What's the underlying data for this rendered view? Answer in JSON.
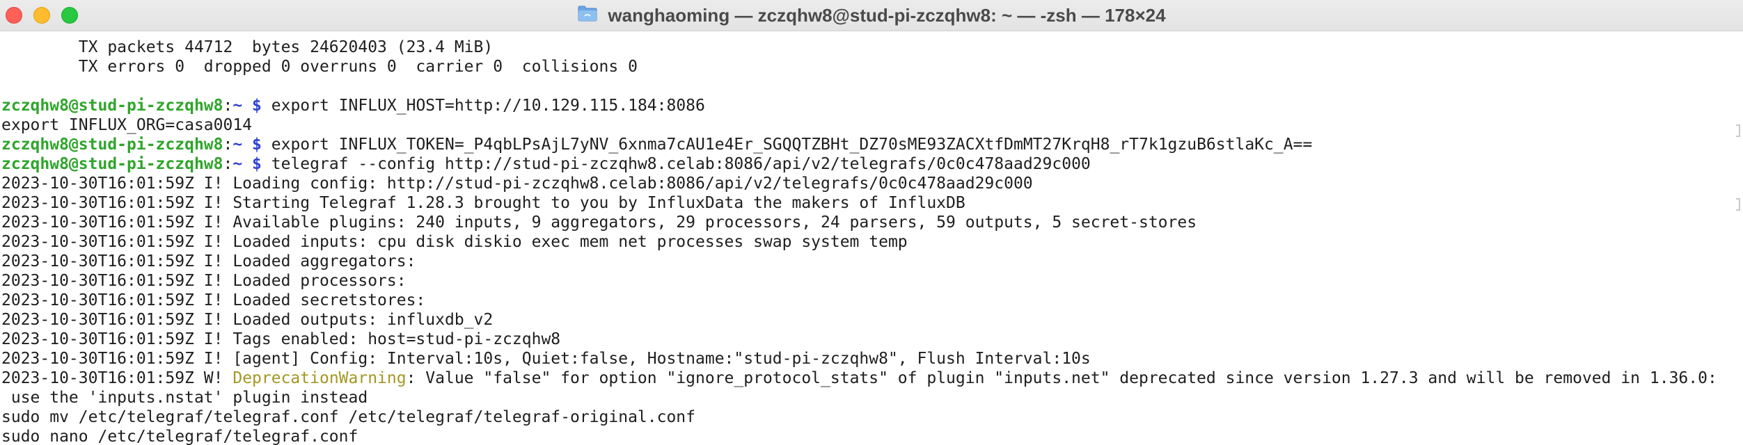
{
  "window": {
    "title": "wanghaoming — zczqhw8@stud-pi-zczqhw8: ~ — -zsh — 178×24",
    "folder_icon": "folder-icon"
  },
  "colors": {
    "prompt_user": "#2fa52b",
    "prompt_path": "#2e41d4",
    "warning": "#a49722",
    "text": "#1e1e1e"
  },
  "terminal": {
    "lines": [
      {
        "text": "        TX packets 44712  bytes 24620403 (23.4 MiB)"
      },
      {
        "text": "        TX errors 0  dropped 0 overruns 0  carrier 0  collisions 0"
      },
      {
        "text": ""
      },
      {
        "prompt_user": "zczqhw8@stud-pi-zczqhw8",
        "prompt_sep": ":",
        "prompt_path": "~ $",
        "text": " export INFLUX_HOST=http://10.129.115.184:8086"
      },
      {
        "text": "export INFLUX_ORG=casa0014"
      },
      {
        "prompt_user": "zczqhw8@stud-pi-zczqhw8",
        "prompt_sep": ":",
        "prompt_path": "~ $",
        "text": " export INFLUX_TOKEN=_P4qbLPsAjL7yNV_6xnma7cAU1e4Er_SGQQTZBHt_DZ70sME93ZACXtfDmMT27KrqH8_rT7k1gzuB6stlaKc_A=="
      },
      {
        "prompt_user": "zczqhw8@stud-pi-zczqhw8",
        "prompt_sep": ":",
        "prompt_path": "~ $",
        "text": " telegraf --config http://stud-pi-zczqhw8.celab:8086/api/v2/telegrafs/0c0c478aad29c000"
      },
      {
        "text": "2023-10-30T16:01:59Z I! Loading config: http://stud-pi-zczqhw8.celab:8086/api/v2/telegrafs/0c0c478aad29c000"
      },
      {
        "text": "2023-10-30T16:01:59Z I! Starting Telegraf 1.28.3 brought to you by InfluxData the makers of InfluxDB"
      },
      {
        "text": "2023-10-30T16:01:59Z I! Available plugins: 240 inputs, 9 aggregators, 29 processors, 24 parsers, 59 outputs, 5 secret-stores"
      },
      {
        "text": "2023-10-30T16:01:59Z I! Loaded inputs: cpu disk diskio exec mem net processes swap system temp"
      },
      {
        "text": "2023-10-30T16:01:59Z I! Loaded aggregators:"
      },
      {
        "text": "2023-10-30T16:01:59Z I! Loaded processors:"
      },
      {
        "text": "2023-10-30T16:01:59Z I! Loaded secretstores:"
      },
      {
        "text": "2023-10-30T16:01:59Z I! Loaded outputs: influxdb_v2"
      },
      {
        "text": "2023-10-30T16:01:59Z I! Tags enabled: host=stud-pi-zczqhw8"
      },
      {
        "text": "2023-10-30T16:01:59Z I! [agent] Config: Interval:10s, Quiet:false, Hostname:\"stud-pi-zczqhw8\", Flush Interval:10s"
      },
      {
        "text": "2023-10-30T16:01:59Z W! ",
        "warn": "DeprecationWarning",
        "text_after": ": Value \"false\" for option \"ignore_protocol_stats\" of plugin \"inputs.net\" deprecated since version 1.27.3 and will be removed in 1.36.0:"
      },
      {
        "text": " use the 'inputs.nstat' plugin instead"
      },
      {
        "text": "sudo mv /etc/telegraf/telegraf.conf /etc/telegraf/telegraf-original.conf"
      },
      {
        "text": "sudo nano /etc/telegraf/telegraf.conf"
      }
    ]
  }
}
